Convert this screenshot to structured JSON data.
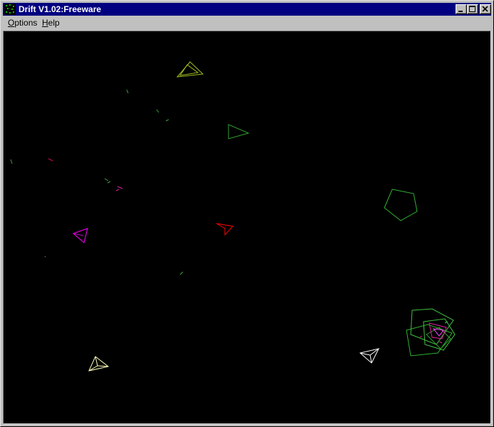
{
  "window": {
    "title": "Drift V1.02:Freeware",
    "title_color": "#000080",
    "controls": [
      "minimize-icon",
      "maximize-icon",
      "close-icon"
    ]
  },
  "menu": {
    "options": {
      "hotkey": "O",
      "rest": "ptions"
    },
    "help": {
      "hotkey": "H",
      "rest": "elp"
    }
  },
  "game": {
    "background": "#000000",
    "entities": [
      {
        "kind": "enemy-ship",
        "color": "#ff0000"
      },
      {
        "kind": "enemy-ship",
        "color": "#ff00ff"
      },
      {
        "kind": "player-ship",
        "color": "#ffffc0"
      },
      {
        "kind": "player-ship",
        "color": "#ffffff"
      },
      {
        "kind": "asteroid-triangle",
        "color": "#30a030"
      },
      {
        "kind": "asteroid-triangle",
        "color": "#a0c020"
      },
      {
        "kind": "asteroid-pentagon",
        "color": "#30b030"
      },
      {
        "kind": "asteroid-cluster",
        "color": "#40c040"
      }
    ]
  }
}
